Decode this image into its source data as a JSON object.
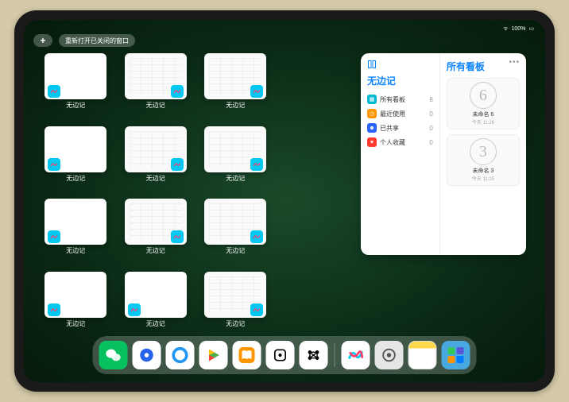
{
  "status": {
    "time": "",
    "battery": "100%",
    "wifi": "●●●"
  },
  "top": {
    "plus": "+",
    "reopen": "重新打开已关闭的窗口"
  },
  "thumbs": {
    "label": "无边记",
    "items": [
      {
        "style": "blank",
        "pos": "left"
      },
      {
        "style": "cal",
        "pos": "right"
      },
      {
        "style": "cal",
        "pos": "right"
      },
      null,
      {
        "style": "blank",
        "pos": "left"
      },
      {
        "style": "cal",
        "pos": "right"
      },
      {
        "style": "cal",
        "pos": "right"
      },
      null,
      {
        "style": "blank",
        "pos": "left"
      },
      {
        "style": "cal",
        "pos": "right"
      },
      {
        "style": "cal",
        "pos": "right"
      },
      null,
      {
        "style": "blank",
        "pos": "left"
      },
      {
        "style": "blank",
        "pos": "left"
      },
      {
        "style": "cal",
        "pos": "right"
      },
      null
    ]
  },
  "panel": {
    "app_title": "无边记",
    "menu": [
      {
        "icon": "grid",
        "color": "#00b8d4",
        "label": "所有看板",
        "count": "8"
      },
      {
        "icon": "clock",
        "color": "#ff9500",
        "label": "最近使用",
        "count": "0"
      },
      {
        "icon": "people",
        "color": "#2962ff",
        "label": "已共享",
        "count": "0"
      },
      {
        "icon": "heart",
        "color": "#ff3b30",
        "label": "个人收藏",
        "count": "0"
      }
    ],
    "right_title": "所有看板",
    "boards": [
      {
        "sketch": "6",
        "name": "未命名 6",
        "time": "今天 11:26"
      },
      {
        "sketch": "3",
        "name": "未命名 3",
        "time": "今天 11:25"
      }
    ]
  },
  "dock": {
    "items": [
      {
        "id": "wechat",
        "glyph": "✦"
      },
      {
        "id": "qblue",
        "glyph": "◉"
      },
      {
        "id": "qcircle",
        "glyph": ""
      },
      {
        "id": "play",
        "glyph": ""
      },
      {
        "id": "books",
        "glyph": ""
      },
      {
        "id": "dice",
        "glyph": "⊡"
      },
      {
        "id": "hex",
        "glyph": "⬡"
      },
      {
        "id": "freeform",
        "glyph": ""
      },
      {
        "id": "settings",
        "glyph": "⚙"
      },
      {
        "id": "notes",
        "glyph": ""
      },
      {
        "id": "folder",
        "glyph": ""
      }
    ]
  }
}
